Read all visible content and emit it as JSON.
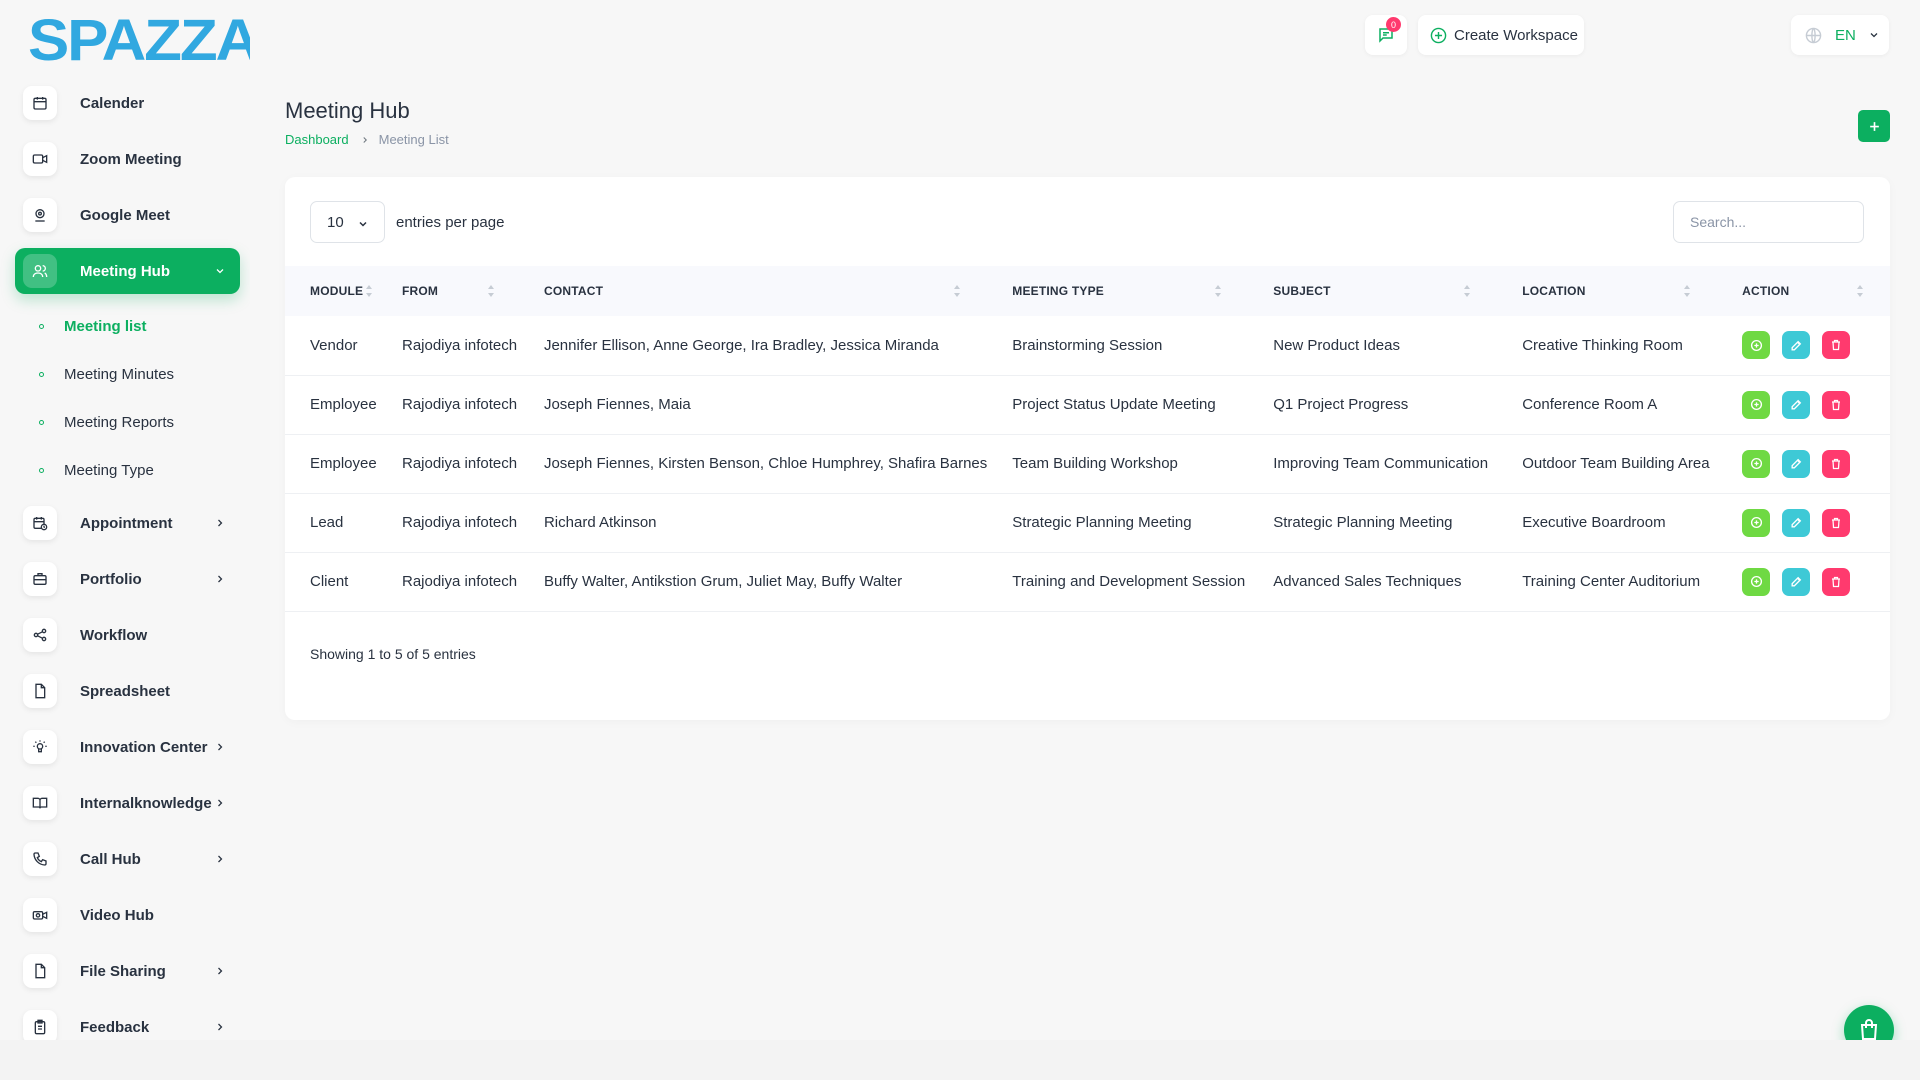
{
  "brand": {
    "logo_text": "SPAZZA",
    "primary_color": "#0caf60",
    "logo_color": "#31a8e0"
  },
  "header": {
    "notification_count": "0",
    "create_workspace_label": "Create Workspace",
    "language_label": "EN"
  },
  "sidebar": {
    "items": [
      {
        "label": "Calender",
        "icon": "calendar-icon"
      },
      {
        "label": "Zoom Meeting",
        "icon": "video-icon"
      },
      {
        "label": "Google Meet",
        "icon": "location-icon"
      },
      {
        "label": "Meeting Hub",
        "icon": "users-icon"
      },
      {
        "label": "Appointment",
        "icon": "calendar-clock-icon"
      },
      {
        "label": "Portfolio",
        "icon": "briefcase-icon"
      },
      {
        "label": "Workflow",
        "icon": "share-icon"
      },
      {
        "label": "Spreadsheet",
        "icon": "file-icon"
      },
      {
        "label": "Innovation Center",
        "icon": "bulb-icon"
      },
      {
        "label": "Internalknowledge",
        "icon": "book-icon"
      },
      {
        "label": "Call Hub",
        "icon": "phone-icon"
      },
      {
        "label": "Video Hub",
        "icon": "camera-icon"
      },
      {
        "label": "File Sharing",
        "icon": "file-icon"
      },
      {
        "label": "Feedback",
        "icon": "clipboard-icon"
      }
    ],
    "submenu": [
      {
        "label": "Meeting list"
      },
      {
        "label": "Meeting Minutes"
      },
      {
        "label": "Meeting Reports"
      },
      {
        "label": "Meeting Type"
      }
    ]
  },
  "page": {
    "title": "Meeting Hub",
    "breadcrumb": [
      "Dashboard",
      "Meeting List"
    ]
  },
  "table": {
    "per_page_value": "10",
    "per_page_label": "entries per page",
    "search_placeholder": "Search...",
    "columns": [
      "Module",
      "From",
      "Contact",
      "Meeting Type",
      "Subject",
      "Location",
      "Action"
    ],
    "rows": [
      {
        "module": "Vendor",
        "from": "Rajodiya infotech",
        "contact": "Jennifer Ellison, Anne George, Ira Bradley, Jessica Miranda",
        "meeting_type": "Brainstorming Session",
        "subject": "New Product Ideas",
        "location": "Creative Thinking Room"
      },
      {
        "module": "Employee",
        "from": "Rajodiya infotech",
        "contact": "Joseph Fiennes, Maia",
        "meeting_type": "Project Status Update Meeting",
        "subject": "Q1 Project Progress",
        "location": "Conference Room A"
      },
      {
        "module": "Employee",
        "from": "Rajodiya infotech",
        "contact": "Joseph Fiennes, Kirsten Benson, Chloe Humphrey, Shafira Barnes",
        "meeting_type": "Team Building Workshop",
        "subject": "Improving Team Communication",
        "location": "Outdoor Team Building Area"
      },
      {
        "module": "Lead",
        "from": "Rajodiya infotech",
        "contact": "Richard Atkinson",
        "meeting_type": "Strategic Planning Meeting",
        "subject": "Strategic Planning Meeting",
        "location": "Executive Boardroom"
      },
      {
        "module": "Client",
        "from": "Rajodiya infotech",
        "contact": "Buffy Walter, Antikstion Grum, Juliet May, Buffy Walter",
        "meeting_type": "Training and Development Session",
        "subject": "Advanced Sales Techniques",
        "location": "Training Center Auditorium"
      }
    ],
    "showing_text": "Showing 1 to 5 of 5 entries"
  }
}
